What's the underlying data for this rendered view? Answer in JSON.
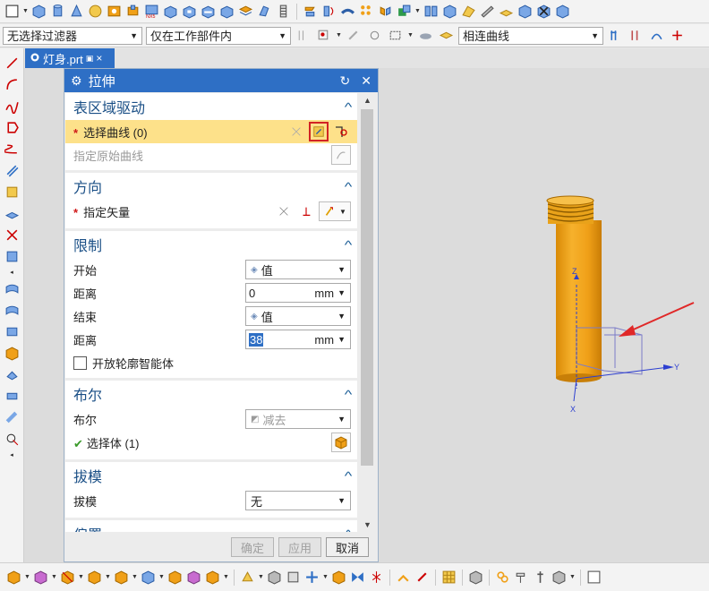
{
  "selection_bar": {
    "filter_value": "无选择过滤器",
    "scope_value": "仅在工作部件内",
    "curve_rule_value": "相连曲线"
  },
  "document_tab": {
    "name": "灯身.prt",
    "close_glyph": "×"
  },
  "dialog": {
    "title": "拉伸",
    "sections": {
      "section_drive": {
        "title": "表区域驱动",
        "select_curve_label": "选择曲线 (0)",
        "origin_curve_label": "指定原始曲线"
      },
      "direction": {
        "title": "方向",
        "vector_label": "指定矢量"
      },
      "limits": {
        "title": "限制",
        "start_label": "开始",
        "start_option": "值",
        "start_distance_label": "距离",
        "start_distance_value": "0",
        "start_unit": "mm",
        "end_label": "结束",
        "end_option": "值",
        "end_distance_label": "距离",
        "end_distance_value": "38",
        "end_unit": "mm",
        "open_profile_label": "开放轮廓智能体"
      },
      "boolean": {
        "title": "布尔",
        "boolean_label": "布尔",
        "boolean_value": "减去",
        "select_body_label": "选择体 (1)"
      },
      "draft": {
        "title": "拔模",
        "draft_label": "拔模",
        "draft_value": "无"
      },
      "offset": {
        "title": "偏置"
      }
    },
    "buttons": {
      "ok": "确定",
      "apply": "应用",
      "cancel": "取消"
    }
  },
  "viewport": {
    "axis_labels": {
      "y": "Y",
      "z": "Z",
      "x": "X"
    },
    "model_color": "#f0a018",
    "arrow_color": "#e02828"
  },
  "colors": {
    "accent_blue": "#2e6fc5",
    "highlight_yellow": "#fde18a",
    "required_red": "#d01919",
    "ok_green": "#3a9a2a"
  }
}
